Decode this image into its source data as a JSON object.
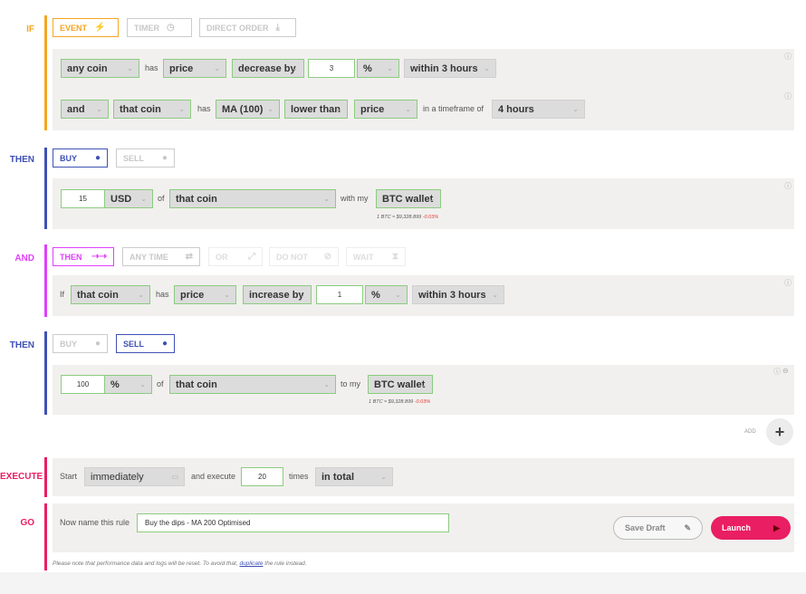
{
  "labels": {
    "if": "IF",
    "then": "THEN",
    "and": "AND",
    "then2": "THEN",
    "execute": "EXECUTE",
    "go": "GO"
  },
  "colors": {
    "if": "#f5a623",
    "then": "#3f51b5",
    "and": "#e040fb",
    "execute": "#e91e63",
    "go": "#e91e63"
  },
  "if_toggles": [
    {
      "label": "EVENT",
      "icon": "bolt-icon",
      "glyph": "⚡"
    },
    {
      "label": "TIMER",
      "icon": "clock-icon",
      "glyph": "◷"
    },
    {
      "label": "DIRECT ORDER",
      "icon": "download-icon",
      "glyph": "⤓"
    }
  ],
  "if_row1": {
    "coin": "any coin",
    "has": "has",
    "metric": "price",
    "direction": "decrease by",
    "amount": "3",
    "unit": "%",
    "window": "within 3 hours"
  },
  "if_row2": {
    "conj": "and",
    "coin": "that coin",
    "has": "has",
    "indicator": "MA (100)",
    "comparison": "lower than",
    "target": "price",
    "timeframe_label": "in a timeframe of",
    "timeframe": "4 hours"
  },
  "then_toggles": [
    {
      "label": "BUY",
      "icon": "arrow-circle-icon",
      "glyph": "●"
    },
    {
      "label": "SELL",
      "icon": "arrow-circle-icon",
      "glyph": "●"
    }
  ],
  "then_row": {
    "amount": "15",
    "currency": "USD",
    "of": "of",
    "coin": "that coin",
    "with_my": "with my",
    "wallet": "BTC wallet",
    "rate": "1 BTC ≈ $9,328.899",
    "change": "-0.03%"
  },
  "and_toggles": [
    {
      "label": "THEN",
      "icon": "double-arrow-icon",
      "glyph": "⇢⇢"
    },
    {
      "label": "ANY TIME",
      "icon": "swap-icon",
      "glyph": "⇄"
    },
    {
      "label": "OR",
      "icon": "branch-icon",
      "glyph": "⤢"
    },
    {
      "label": "DO NOT",
      "icon": "block-icon",
      "glyph": "⊘"
    },
    {
      "label": "WAIT",
      "icon": "hourglass-icon",
      "glyph": "⧗"
    }
  ],
  "and_row": {
    "if": "If",
    "coin": "that coin",
    "has": "has",
    "metric": "price",
    "direction": "increase by",
    "amount": "1",
    "unit": "%",
    "window": "within 3 hours"
  },
  "then2_toggles": [
    {
      "label": "BUY",
      "icon": "arrow-circle-icon",
      "glyph": "●"
    },
    {
      "label": "SELL",
      "icon": "arrow-circle-icon",
      "glyph": "●"
    }
  ],
  "then2_row": {
    "amount": "100",
    "unit": "%",
    "of": "of",
    "coin": "that coin",
    "to_my": "to my",
    "wallet": "BTC wallet",
    "rate": "1 BTC ≈ $9,328.899",
    "change": "-0.03%"
  },
  "add": {
    "label": "ADD",
    "glyph": "+"
  },
  "execute": {
    "start": "Start",
    "when": "immediately",
    "and_execute": "and execute",
    "times_value": "20",
    "times": "times",
    "scope": "in total"
  },
  "go": {
    "prompt": "Now name this rule",
    "name": "Buy the dips - MA 200 Optimised",
    "save": "Save Draft",
    "launch": "Launch"
  },
  "note": {
    "before": "Please note that performance data and logs will be reset. To avoid that,",
    "link": "duplicate",
    "after": "the rule instead."
  }
}
